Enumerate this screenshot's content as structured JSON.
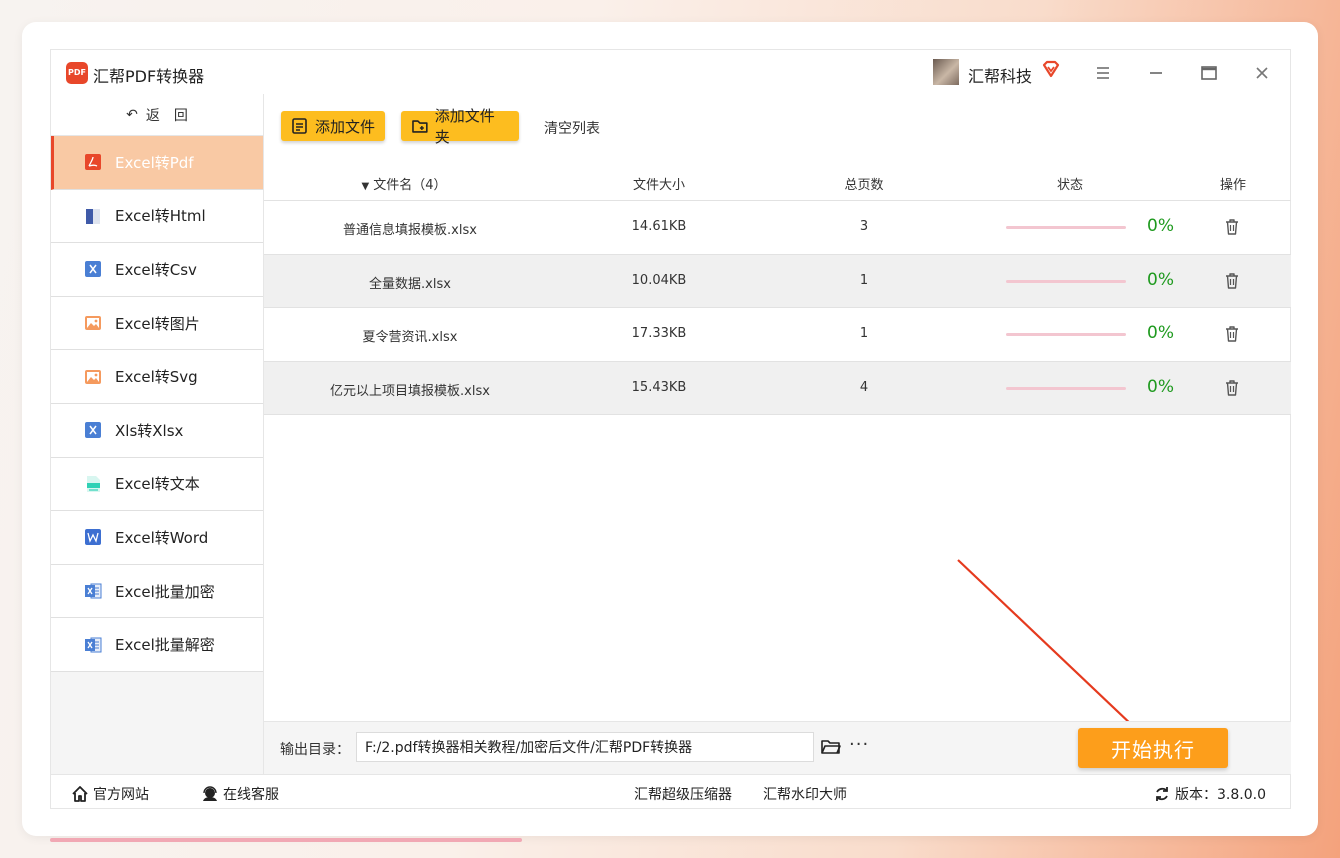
{
  "app": {
    "title": "汇帮PDF转换器",
    "logo_text": "PDF"
  },
  "user": {
    "name": "汇帮科技"
  },
  "sidebar": {
    "back_label": "返　回",
    "items": [
      {
        "label": "Excel转Pdf",
        "icon": "pdf-icon",
        "active": true
      },
      {
        "label": "Excel转Html",
        "icon": "html-doc-icon"
      },
      {
        "label": "Excel转Csv",
        "icon": "excel-x-icon"
      },
      {
        "label": "Excel转图片",
        "icon": "image-icon"
      },
      {
        "label": "Excel转Svg",
        "icon": "image-icon"
      },
      {
        "label": "Xls转Xlsx",
        "icon": "excel-x-icon"
      },
      {
        "label": "Excel转文本",
        "icon": "text-doc-icon"
      },
      {
        "label": "Excel转Word",
        "icon": "word-icon"
      },
      {
        "label": "Excel批量加密",
        "icon": "excel-file-icon"
      },
      {
        "label": "Excel批量解密",
        "icon": "excel-file-icon"
      }
    ]
  },
  "toolbar": {
    "add_file": "添加文件",
    "add_folder": "添加文件夹",
    "clear_list": "清空列表"
  },
  "table": {
    "headers": {
      "name": "文件名（4）",
      "size": "文件大小",
      "pages": "总页数",
      "status": "状态",
      "action": "操作"
    },
    "rows": [
      {
        "name": "普通信息填报模板.xlsx",
        "size": "14.61KB",
        "pages": "3",
        "progress": 0,
        "percent": "0%"
      },
      {
        "name": "全量数据.xlsx",
        "size": "10.04KB",
        "pages": "1",
        "progress": 0,
        "percent": "0%"
      },
      {
        "name": "夏令营资讯.xlsx",
        "size": "17.33KB",
        "pages": "1",
        "progress": 0,
        "percent": "0%"
      },
      {
        "name": "亿元以上项目填报模板.xlsx",
        "size": "15.43KB",
        "pages": "4",
        "progress": 0,
        "percent": "0%"
      }
    ]
  },
  "output": {
    "label": "输出目录：",
    "path": "F:/2.pdf转换器相关教程/加密后文件/汇帮PDF转换器",
    "more": "···"
  },
  "start_button": "开始执行",
  "footer": {
    "website": "官方网站",
    "support": "在线客服",
    "compressor": "汇帮超级压缩器",
    "watermark": "汇帮水印大师",
    "version": "版本：3.8.0.0"
  },
  "colors": {
    "accent_orange": "#fd9e1b",
    "button_yellow": "#fdbd1f",
    "active_nav_bg": "#f9c9a4",
    "brand_red": "#e8472a",
    "percent_green": "#1f9a1f"
  }
}
